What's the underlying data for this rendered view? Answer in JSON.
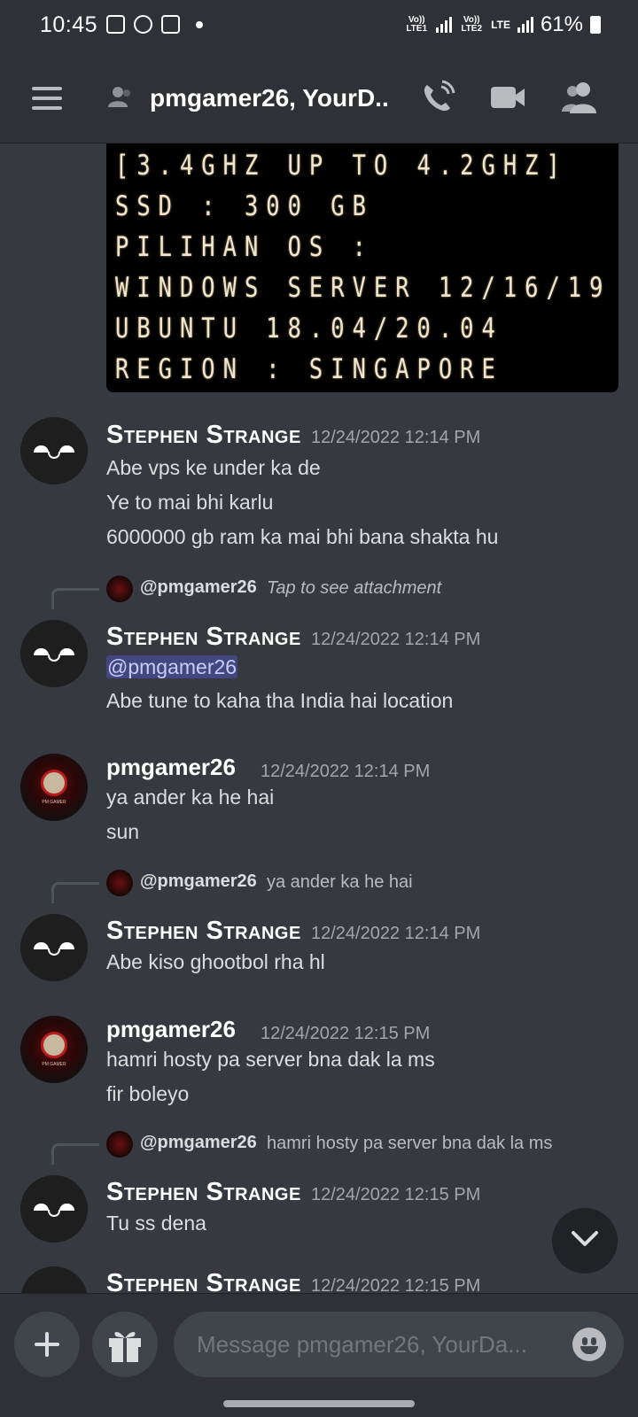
{
  "status_bar": {
    "time": "10:45",
    "sim1": "Vo)) LTE1",
    "sim2": "Vo)) LTE2",
    "network": "LTE",
    "battery": "61%"
  },
  "header": {
    "title": "pmgamer26, YourD..",
    "icons": [
      "hamburger-menu-icon",
      "dm-group-icon",
      "voice-call-icon",
      "video-call-icon",
      "members-icon"
    ]
  },
  "attachment_image": {
    "lines": [
      "[3.4GHZ UP TO 4.2GHZ]",
      "SSD : 300 GB",
      "PILIHAN OS :",
      "WINDOWS SERVER 12/16/19",
      "UBUNTU 18.04/20.04",
      "REGION : SINGAPORE"
    ]
  },
  "messages": [
    {
      "author": "Stephen Strange",
      "timestamp": "12/24/2022 12:14 PM",
      "lines": [
        "Abe vps ke under ka de",
        "Ye to mai bhi karlu",
        "6000000 gb  ram ka mai bhi bana shakta hu"
      ]
    },
    {
      "reply": {
        "name": "@pmgamer26",
        "text": "Tap to see attachment"
      },
      "author": "Stephen Strange",
      "timestamp": "12/24/2022 12:14 PM",
      "mention": "@pmgamer26",
      "lines": [
        "Abe tune to kaha tha India hai location"
      ]
    },
    {
      "author": "pmgamer26",
      "timestamp": "12/24/2022 12:14 PM",
      "lines": [
        "ya ander ka he hai",
        "sun"
      ]
    },
    {
      "reply": {
        "name": "@pmgamer26",
        "text": "ya ander ka he hai"
      },
      "author": "Stephen Strange",
      "timestamp": "12/24/2022 12:14 PM",
      "lines": [
        "Abe kiso ghootbol rha hl"
      ]
    },
    {
      "author": "pmgamer26",
      "timestamp": "12/24/2022 12:15 PM",
      "lines": [
        "hamri hosty pa server bna dak la ms",
        "fir boleyo"
      ]
    },
    {
      "reply": {
        "name": "@pmgamer26",
        "text": "hamri hosty pa server bna dak la ms"
      },
      "author": "Stephen Strange",
      "timestamp": "12/24/2022 12:15 PM",
      "lines": [
        "Tu ss dena"
      ]
    },
    {
      "author": "Stephen Strange",
      "timestamp": "12/24/2022 12:15 PM",
      "lines": []
    }
  ],
  "avatar_tag": "PM GAMER",
  "composer": {
    "placeholder": "Message pmgamer26, YourDa..."
  }
}
